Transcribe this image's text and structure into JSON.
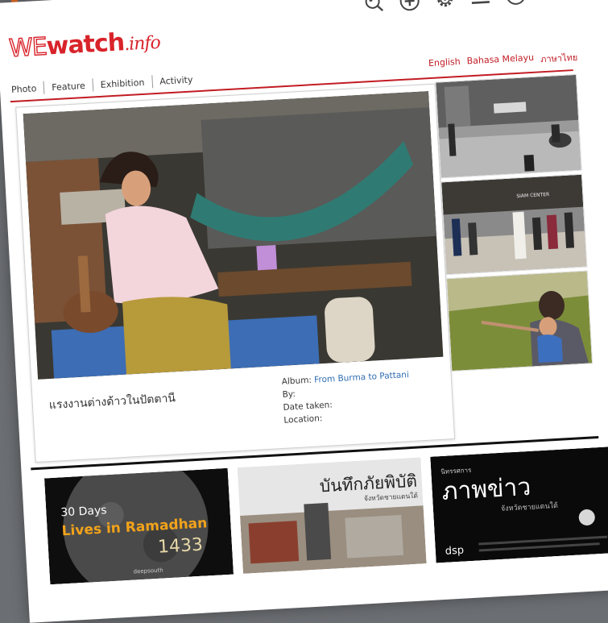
{
  "site": {
    "logo_we": "WE",
    "logo_watch": "watch",
    "logo_info": ".info"
  },
  "header": {
    "icons": [
      "search-icon",
      "plus-circle-icon",
      "gear-icon",
      "menu-icon",
      "upload-icon"
    ]
  },
  "nav": {
    "items": [
      "Photo",
      "Feature",
      "Exhibition",
      "Activity"
    ]
  },
  "languages": [
    "English",
    "Bahasa Melayu",
    "ภาษาไทย"
  ],
  "featured": {
    "title": "แรงงานต่างด้าวในปัตตานี",
    "album_label": "Album:",
    "album_value": "From Burma to Pattani",
    "by_label": "By:",
    "date_label": "Date taken:",
    "location_label": "Location:"
  },
  "side_photos": {
    "sign_text": "SIAM CENTER"
  },
  "tiles": {
    "t1_line1": "30 Days",
    "t1_line2": "Lives in Ramadhan",
    "t1_year": "1433",
    "t1_footer": "deepsouth",
    "t2_title": "บันทึกภัยพิบัติ",
    "t2_sub": "จังหวัดชายแดนใต้",
    "t3_small": "นิทรรศการ",
    "t3_title": "ภาพข่าว",
    "t3_sub": "จังหวัดชายแดนใต้",
    "t3_logo": "dsp"
  },
  "colors": {
    "brand_red": "#d8232a",
    "link_blue": "#2f6db1",
    "accent_orange": "#e8702a"
  }
}
